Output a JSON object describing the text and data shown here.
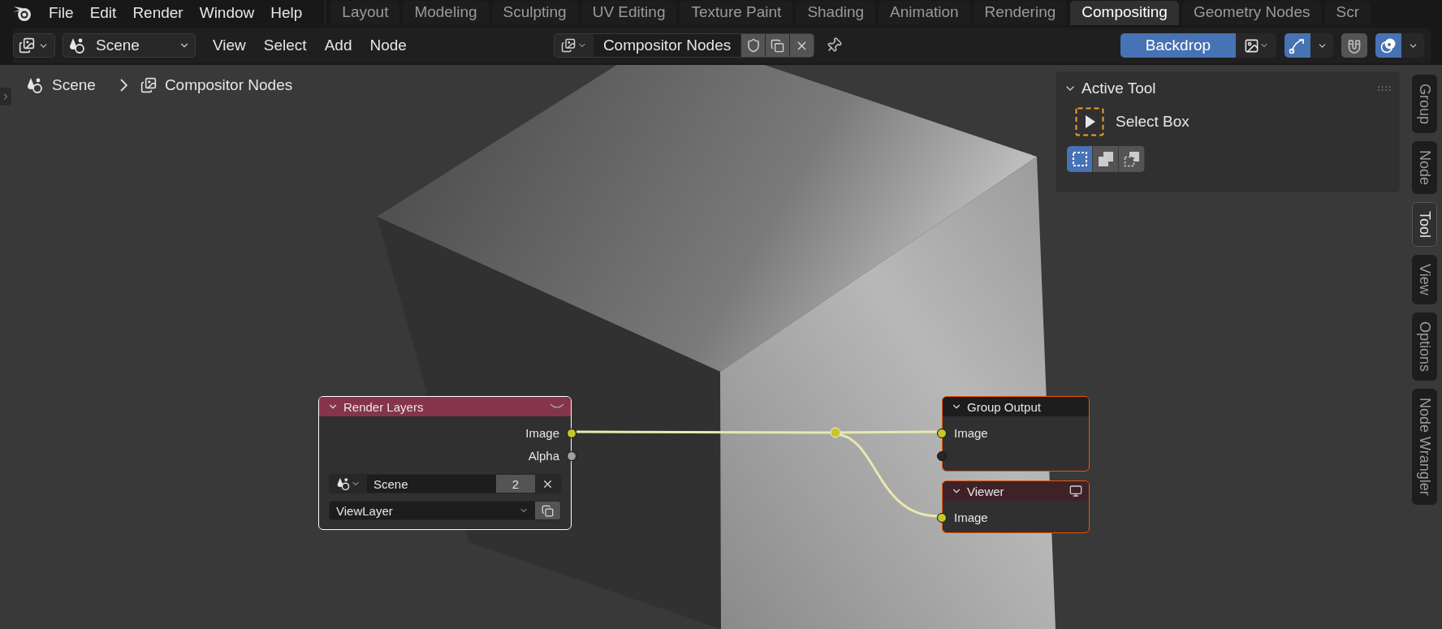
{
  "menu": [
    "File",
    "Edit",
    "Render",
    "Window",
    "Help"
  ],
  "workspaces": [
    {
      "label": "Layout",
      "selected": false
    },
    {
      "label": "Modeling",
      "selected": false
    },
    {
      "label": "Sculpting",
      "selected": false
    },
    {
      "label": "UV Editing",
      "selected": false
    },
    {
      "label": "Texture Paint",
      "selected": false
    },
    {
      "label": "Shading",
      "selected": false
    },
    {
      "label": "Animation",
      "selected": false
    },
    {
      "label": "Rendering",
      "selected": false
    },
    {
      "label": "Compositing",
      "selected": true
    },
    {
      "label": "Geometry Nodes",
      "selected": false
    },
    {
      "label": "Scr",
      "selected": false
    }
  ],
  "header": {
    "scene": "Scene",
    "menus": [
      "View",
      "Select",
      "Add",
      "Node"
    ],
    "node_tree": "Compositor Nodes",
    "backdrop": {
      "label": "Backdrop",
      "on": true
    },
    "toggles": [
      {
        "kind": "links",
        "on": true
      },
      {
        "kind": "snap",
        "on": false
      },
      {
        "kind": "overlay",
        "on": true
      }
    ]
  },
  "breadcrumb": [
    "Scene",
    "Compositor Nodes"
  ],
  "active_tool": {
    "title": "Active Tool",
    "expanded": true,
    "tool": "Select Box",
    "modes": [
      {
        "kind": "set",
        "selected": true
      },
      {
        "kind": "extend",
        "selected": false
      },
      {
        "kind": "subtract",
        "selected": false
      }
    ]
  },
  "sidebar_tabs": [
    {
      "label": "Group",
      "selected": false
    },
    {
      "label": "Node",
      "selected": false
    },
    {
      "label": "Tool",
      "selected": true
    },
    {
      "label": "View",
      "selected": false
    },
    {
      "label": "Options",
      "selected": false
    },
    {
      "label": "Node Wrangler",
      "selected": false
    }
  ],
  "nodes": [
    {
      "kind": "render_layers",
      "title": "Render Layers",
      "expanded": true,
      "active": true,
      "outputs": [
        {
          "name": "Image",
          "color": "#c7c729"
        },
        {
          "name": "Alpha",
          "color": "#a1a1a1"
        }
      ],
      "scene": "Scene",
      "users": "2",
      "view_layer": "ViewLayer"
    },
    {
      "kind": "group_output",
      "title": "Group Output",
      "expanded": true,
      "active": false,
      "inputs": [
        {
          "name": "Image",
          "color": "#c7c729"
        },
        {
          "color": "#282828"
        }
      ]
    },
    {
      "kind": "viewer",
      "title": "Viewer",
      "expanded": true,
      "active": false,
      "inputs": [
        {
          "name": "Image",
          "color": "#c7c729"
        }
      ]
    }
  ]
}
